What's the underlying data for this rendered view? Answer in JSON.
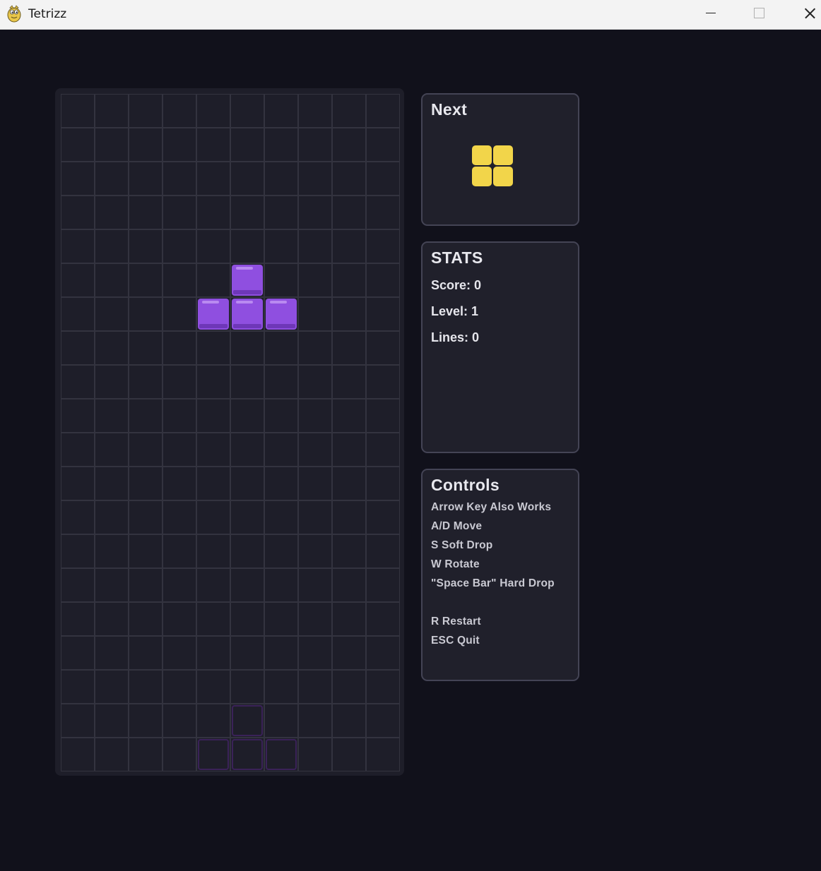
{
  "window": {
    "title": "Tetrizz",
    "icon": "python-snake-icon"
  },
  "game": {
    "board": {
      "columns": 10,
      "rows": 20,
      "background_color": "#1e1e29",
      "grid_line_color": "#33333f",
      "active_piece": {
        "shape": "T",
        "color": "#8f4fe0",
        "cells": [
          [
            5,
            5
          ],
          [
            4,
            6
          ],
          [
            5,
            6
          ],
          [
            6,
            6
          ]
        ]
      },
      "ghost_piece": {
        "color": "#3a2258",
        "cells": [
          [
            5,
            18
          ],
          [
            4,
            19
          ],
          [
            5,
            19
          ],
          [
            6,
            19
          ]
        ]
      }
    },
    "next": {
      "title": "Next",
      "shape": "O",
      "color": "#f2d54a"
    },
    "stats": {
      "title": "STATS",
      "score_text": "Score: 0",
      "level_text": "Level: 1",
      "lines_text": "Lines: 0"
    },
    "controls": {
      "title": "Controls",
      "lines": [
        "Arrow Key Also Works",
        "A/D Move",
        "S Soft Drop",
        "W Rotate",
        "\"Space Bar\" Hard Drop",
        "R Restart",
        "ESC Quit"
      ]
    }
  },
  "colors": {
    "window_background": "#11111b",
    "panel_background": "#20202b",
    "panel_border": "#444455",
    "text_primary": "#e8e8ee"
  }
}
